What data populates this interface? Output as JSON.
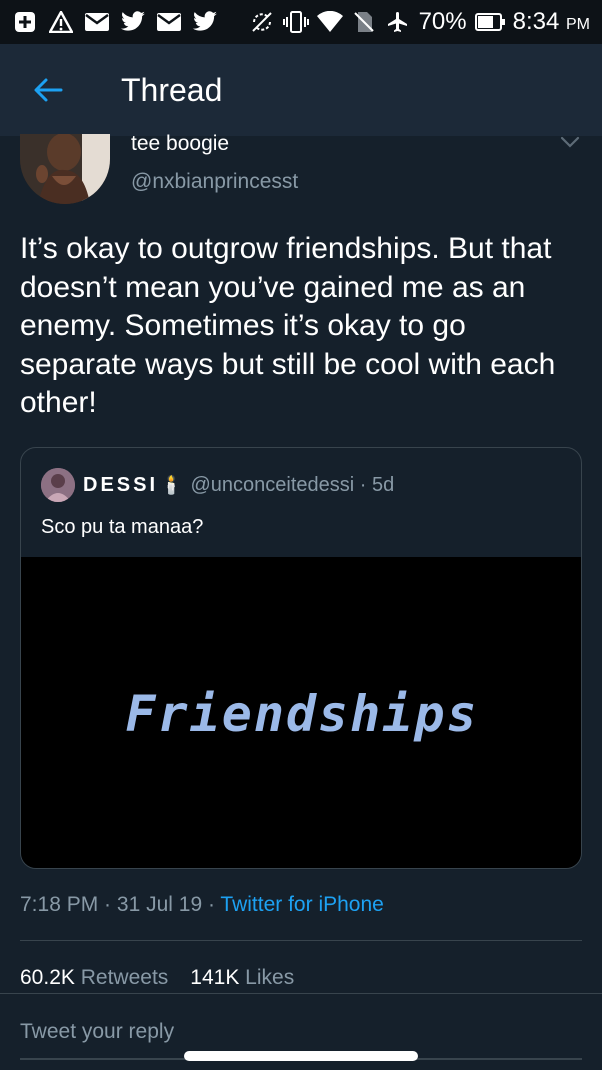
{
  "status_bar": {
    "icons_left": [
      "add-icon",
      "warning-icon",
      "mail-icon",
      "twitter-bird-icon",
      "mail-icon",
      "twitter-bird-icon"
    ],
    "icons_right": [
      "sync-off-icon",
      "vibrate-icon",
      "wifi-icon",
      "no-sim-icon",
      "airplane-icon"
    ],
    "battery": "70%",
    "time": "8:34",
    "ampm": "PM"
  },
  "appbar": {
    "title": "Thread"
  },
  "tweet": {
    "name": "tee boogie",
    "handle": "@nxbianprincesst",
    "text": "It’s okay to outgrow friendships. But that doesn’t mean you’ve gained me as an enemy. Sometimes it’s okay to go separate ways but still be cool with each other!",
    "time": "7:18 PM",
    "date": "31 Jul 19",
    "source": "Twitter for iPhone",
    "retweets": "60.2K",
    "retweets_label": "Retweets",
    "likes": "141K",
    "likes_label": "Likes"
  },
  "quote": {
    "name": "DESSI",
    "emoji": "🕯️",
    "handle": "@unconceitedessi",
    "age": "· 5d",
    "text": "Sco pu ta manaa?",
    "media_text": "Friendships"
  },
  "reply": {
    "placeholder": "Tweet your reply"
  },
  "colors": {
    "background": "#15202b",
    "accent": "#1da1f2",
    "muted": "#8899a6"
  }
}
